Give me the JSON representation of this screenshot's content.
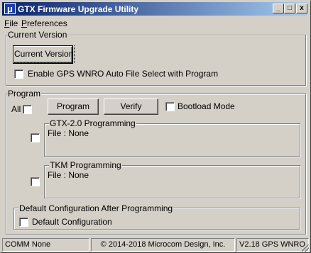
{
  "window": {
    "title": "GTX Firmware Upgrade Utility",
    "app_icon_glyph": "μ",
    "controls": {
      "minimize": "_",
      "maximize": "□",
      "close": "x"
    }
  },
  "menu": {
    "items": [
      {
        "label": "File",
        "mnemonic": "F",
        "rest": "ile"
      },
      {
        "label": "Preferences",
        "mnemonic": "P",
        "rest": "references"
      }
    ]
  },
  "current_version": {
    "group_label": "Current Version",
    "button_label": "Current Version",
    "gps_checkbox_label": "Enable GPS WNRO Auto File Select with Program"
  },
  "program": {
    "group_label": "Program",
    "all_label": "All",
    "program_button": "Program",
    "verify_button": "Verify",
    "bootload_label": "Bootload Mode",
    "gtx_group_label": "GTX-2.0 Programming",
    "gtx_file_text": "File : None",
    "tkm_group_label": "TKM Programming",
    "tkm_file_text": "File : None",
    "default_config_group_label": "Default Configuration After Programming",
    "default_config_checkbox_label": "Default Configuration"
  },
  "statusbar": {
    "comm": "COMM None",
    "copyright": "© 2014-2018 Microcom Design, Inc.",
    "version": "V2.18 GPS WNRO"
  }
}
